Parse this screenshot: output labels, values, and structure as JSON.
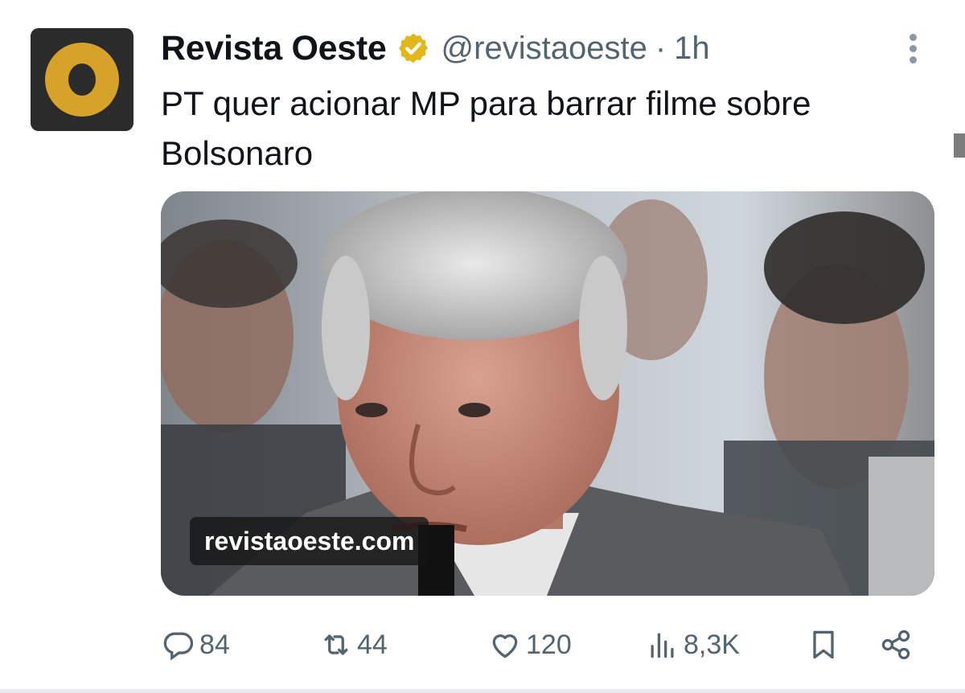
{
  "tweet": {
    "display_name": "Revista Oeste",
    "handle": "@revistaoeste",
    "separator": "·",
    "time": "1h",
    "text": "PT quer acionar MP para barrar filme sobre Bolsonaro",
    "verified": true,
    "avatar_letter": "O"
  },
  "media": {
    "watermark": "revistaoeste.com"
  },
  "actions": {
    "replies": "84",
    "reposts": "44",
    "likes": "120",
    "views": "8,3K"
  },
  "icons": {
    "badge": "verified-badge-icon",
    "more": "more-vertical-icon",
    "reply": "reply-icon",
    "repost": "repost-icon",
    "like": "heart-icon",
    "views": "analytics-icon",
    "bookmark": "bookmark-icon",
    "share": "share-icon"
  },
  "colors": {
    "badge_gold": "#e2b719",
    "avatar_bg": "#2b2b2b",
    "avatar_ring": "#d6a22a",
    "secondary_text": "#536471"
  }
}
